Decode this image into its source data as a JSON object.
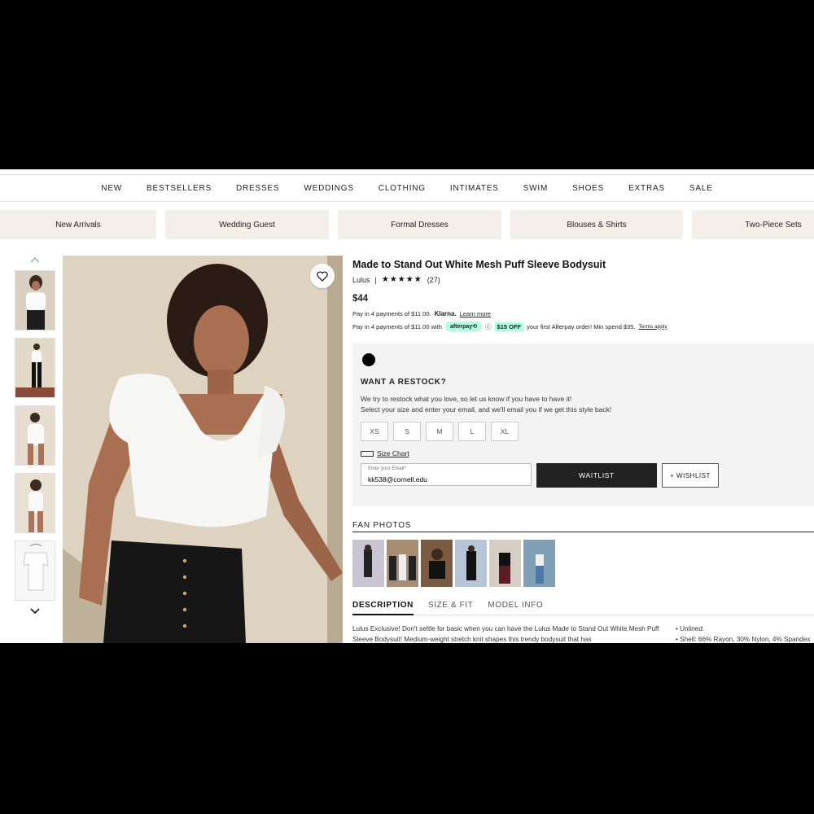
{
  "nav": {
    "items": [
      "NEW",
      "BESTSELLERS",
      "DRESSES",
      "WEDDINGS",
      "CLOTHING",
      "INTIMATES",
      "SWIM",
      "SHOES",
      "EXTRAS",
      "SALE"
    ]
  },
  "categories": [
    "New Arrivals",
    "Wedding Guest",
    "Formal Dresses",
    "Blouses & Shirts",
    "Two-Piece Sets"
  ],
  "product": {
    "title": "Made to Stand Out White Mesh Puff Sleeve Bodysuit",
    "brand": "Lulus",
    "stars": "★★★★★",
    "rating_count": "(27)",
    "price": "$44"
  },
  "payments": {
    "klarna_prefix": "Pay in 4 payments of $11.00.",
    "klarna_brand": "Klarna.",
    "klarna_link": "Learn more",
    "afterpay_prefix": "Pay in 4 payments of $11.00 with",
    "afterpay_brand": "afterpay⟲",
    "afterpay_info": "ⓘ",
    "afterpay_offer": "$15 OFF",
    "afterpay_suffix": "your first Afterpay order! Min spend $35.",
    "afterpay_terms": "Terms apply"
  },
  "restock": {
    "title": "WANT A RESTOCK?",
    "line1": "We try to restock what you love, so let us know if you have to have it!",
    "line2": "Select your size and enter your email, and we'll email you if we get this style back!",
    "sizes": [
      "XS",
      "S",
      "M",
      "L",
      "XL"
    ],
    "size_chart": "Size Chart",
    "email_label": "Enter your Email*",
    "email_value": "kk538@cornell.edu",
    "waitlist": "WAITLIST",
    "wishlist": "+ WISHLIST"
  },
  "fan_photos_title": "FAN PHOTOS",
  "tabs": [
    "DESCRIPTION",
    "SIZE & FIT",
    "MODEL INFO"
  ],
  "description": {
    "text": "Lulus Exclusive! Don't settle for basic when you can have the Lulus Made to Stand Out White Mesh Puff Sleeve Bodysuit! Medium-weight stretch knit shapes this trendy bodysuit that has",
    "bullet1": "• Unlined.",
    "bullet2": "• Shell: 66% Rayon, 30% Nylon, 4% Spandex"
  },
  "icons": {
    "wish": "heart-icon",
    "up": "chevron-up-icon",
    "down": "chevron-down-icon"
  },
  "colors": {
    "chip_bg": "#f5efe9",
    "afterpay_mint": "#b2fce4",
    "button_dark": "#222222"
  }
}
